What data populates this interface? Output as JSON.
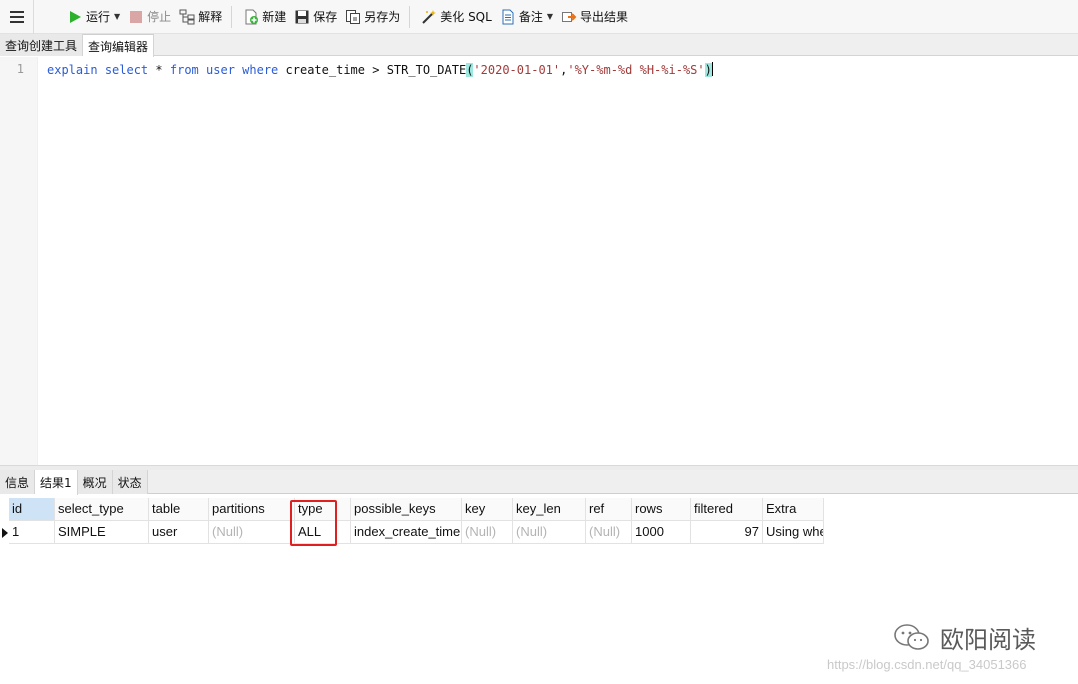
{
  "toolbar": {
    "run_label": "运行",
    "stop_label": "停止",
    "explain_label": "解释",
    "new_label": "新建",
    "save_label": "保存",
    "save_as_label": "另存为",
    "beautify_label": "美化 SQL",
    "notes_label": "备注",
    "export_label": "导出结果"
  },
  "top_tabs": [
    {
      "label": "查询创建工具"
    },
    {
      "label": "查询编辑器"
    }
  ],
  "editor": {
    "line_number": "1",
    "tokens": {
      "explain": "explain",
      "select": "select",
      "star": "*",
      "from": "from",
      "table": "user",
      "where": "where",
      "column": "create_time",
      "op": ">",
      "func": "STR_TO_DATE",
      "open_paren": "(",
      "arg1": "'2020-01-01'",
      "comma": ",",
      "arg2": "'%Y-%m-%d %H-%i-%S'",
      "close_paren": ")"
    }
  },
  "result_tabs": [
    {
      "label": "信息"
    },
    {
      "label": "结果1"
    },
    {
      "label": "概况"
    },
    {
      "label": "状态"
    }
  ],
  "grid": {
    "columns": [
      "id",
      "select_type",
      "table",
      "partitions",
      "type",
      "possible_keys",
      "key",
      "key_len",
      "ref",
      "rows",
      "filtered",
      "Extra"
    ],
    "row": [
      "1",
      "SIMPLE",
      "user",
      "(Null)",
      "ALL",
      "index_create_time",
      "(Null)",
      "(Null)",
      "(Null)",
      "1000",
      "97",
      "Using whe"
    ]
  },
  "watermark": {
    "name": "欧阳阅读",
    "url": "https://blog.csdn.net/qq_34051366"
  },
  "colors": {
    "keyword": "#2a5cd8",
    "string": "#a33a3a",
    "highlight": "#e02020",
    "run_green": "#2bb12b"
  }
}
